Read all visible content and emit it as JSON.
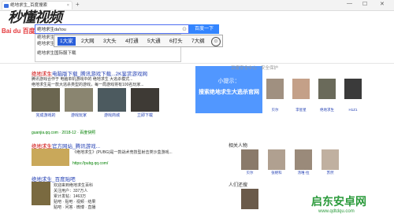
{
  "browser": {
    "tab_title": "绝地求生_百度搜索",
    "newtab": "+",
    "win_min": "—",
    "win_max": "☐",
    "win_close": "✕"
  },
  "watermark": "秒懂视频",
  "baidu": {
    "logo": "Bai du 百度",
    "query": "绝地求生da'tou",
    "search_label": "百度一下"
  },
  "suggestions": [
    "绝地求生助",
    "绝地求生提",
    "绝地求生国际服下载"
  ],
  "ime": {
    "candidates": [
      "1大家",
      "2大网",
      "3大头",
      "4打通",
      "5大通",
      "6打头",
      "7大纲"
    ],
    "emoji": "☺"
  },
  "overlay": {
    "heading": "小提示：",
    "body": "搜索绝地求生大逃杀官网"
  },
  "results": {
    "r1_title_a": "绝地求生",
    "r1_title_b": "电脑版下载_腾讯游戏下载...2K鉴赏游戏网",
    "r1_desc1": "腾讯游戏合作于 电脑单机游戏中的 绝地求生 大逃杀模式...",
    "r1_desc2": "绝地求生是一款大逃杀类型的游戏，每一局游戏将有100名玩家...",
    "r1_caps": [
      "完成游戏的",
      "游戏玩家",
      "游戏商城",
      "立即下载"
    ],
    "r1_url": "guanjia.qq.com · 2018-12 · 百度快照",
    "r2_title_a": "绝地求生",
    "r2_title_b": "官方网站_腾讯游戏...",
    "r2_desc": "《绝地求生》(PUBG)是一款战术竞技型射击类沙盒游戏...",
    "r2_url": "https://pubg.qq.com/",
    "r3_title": "绝地求生_百度贴吧",
    "r3_l1": "欢迎来到绝地求生百科",
    "r3_l2": "关注用户：337万人",
    "r3_l3": "累计发帖：1463万",
    "r3_l4": "贴吧 · 贴吧 · 视频 · 结果",
    "r3_l5": "贴吧 · 问答 · 微博 · 直播"
  },
  "right": {
    "baidu_safe": "百度安全中心 · 安全保护",
    "related": "相关人物",
    "more": "人们还搜",
    "top_caps": [
      "贝尔",
      "李星星",
      "绝地求生",
      "H1Z1"
    ],
    "mid_caps": [
      "贝尔",
      "张继科",
      "汤唯·拉",
      "苏然"
    ]
  },
  "site_logo": "启东安卓网",
  "site_url": "www.qdtdqu.com"
}
